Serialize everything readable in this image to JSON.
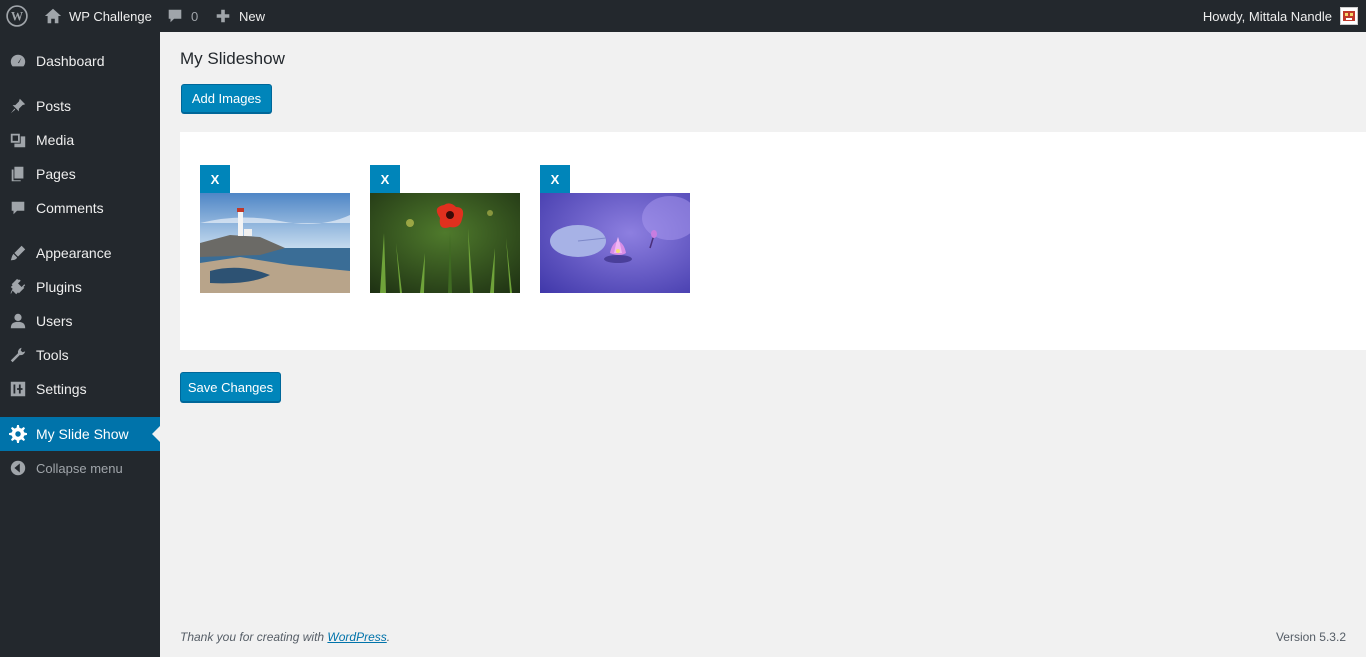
{
  "adminbar": {
    "site_name": "WP Challenge",
    "comments_count": "0",
    "new_label": "New",
    "howdy": "Howdy, Mittala Nandle"
  },
  "menu": {
    "items": [
      {
        "label": "Dashboard",
        "icon": "dashboard-icon"
      },
      {
        "label": "Posts",
        "icon": "pushpin-icon"
      },
      {
        "label": "Media",
        "icon": "media-icon"
      },
      {
        "label": "Pages",
        "icon": "pages-icon"
      },
      {
        "label": "Comments",
        "icon": "comment-icon"
      },
      {
        "label": "Appearance",
        "icon": "paintbrush-icon"
      },
      {
        "label": "Plugins",
        "icon": "plugin-icon"
      },
      {
        "label": "Users",
        "icon": "users-icon"
      },
      {
        "label": "Tools",
        "icon": "wrench-icon"
      },
      {
        "label": "Settings",
        "icon": "settings-icon"
      },
      {
        "label": "My Slide Show",
        "icon": "gear-icon"
      }
    ],
    "collapse_label": "Collapse menu"
  },
  "page": {
    "title": "My Slideshow",
    "add_images_label": "Add Images",
    "save_label": "Save Changes",
    "images": [
      {
        "remove_label": "X",
        "subject": "lighthouse"
      },
      {
        "remove_label": "X",
        "subject": "red poppy"
      },
      {
        "remove_label": "X",
        "subject": "water lily"
      }
    ]
  },
  "footer": {
    "thanks_prefix": "Thank you for creating with ",
    "thanks_link": "WordPress",
    "thanks_suffix": ".",
    "version": "Version 5.3.2"
  },
  "colors": {
    "accent": "#0085ba",
    "menu_bg": "#23282d",
    "current_bg": "#0073aa"
  }
}
